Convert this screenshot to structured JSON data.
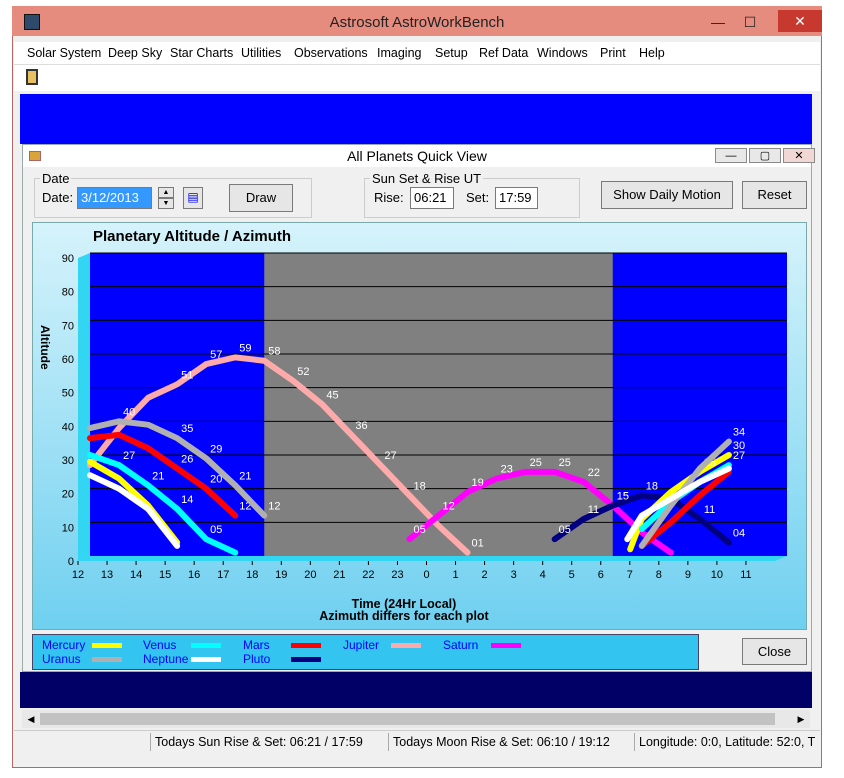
{
  "app": {
    "title": "Astrosoft AstroWorkBench",
    "window_buttons": {
      "minimize": "—",
      "maximize": "☐",
      "close": "✕"
    }
  },
  "menu": [
    "Solar System",
    "Deep Sky",
    "Star Charts",
    "Utilities",
    "Observations",
    "Imaging",
    "Setup",
    "Ref Data",
    "Windows",
    "Print",
    "Help"
  ],
  "child": {
    "title": "All Planets Quick View",
    "window_buttons": {
      "minimize": "—",
      "maximize": "▢",
      "close": "✕"
    },
    "date_group": {
      "title": "Date",
      "date_label": "Date:",
      "date_value": "3/12/2013"
    },
    "draw_label": "Draw",
    "sun_group": {
      "title": "Sun Set & Rise UT",
      "rise_label": "Rise:",
      "rise_value": "06:21",
      "set_label": "Set:",
      "set_value": "17:59"
    },
    "show_daily_motion_label": "Show Daily Motion",
    "reset_label": "Reset",
    "close_label": "Close"
  },
  "legend": [
    {
      "name": "Mercury",
      "color": "#ffff00"
    },
    {
      "name": "Venus",
      "color": "#00ffff"
    },
    {
      "name": "Mars",
      "color": "#ff0000"
    },
    {
      "name": "Jupiter",
      "color": "#ffaaaa"
    },
    {
      "name": "Saturn",
      "color": "#ff00ff"
    },
    {
      "name": "Uranus",
      "color": "#b0b0b0"
    },
    {
      "name": "Neptune",
      "color": "#ffffff"
    },
    {
      "name": "Pluto",
      "color": "#000080"
    }
  ],
  "chart_data": {
    "type": "line",
    "title": "Planetary Altitude / Azimuth",
    "xlabel": "Time (24Hr Local)",
    "xlabel2": "Azimuth differs for each plot",
    "ylabel": "Altitude",
    "ylim": [
      0,
      90
    ],
    "yticks": [
      "0",
      "10",
      "20",
      "30",
      "40",
      "50",
      "60",
      "70",
      "80",
      "90"
    ],
    "xticks": [
      "12",
      "13",
      "14",
      "15",
      "16",
      "17",
      "18",
      "19",
      "20",
      "21",
      "22",
      "23",
      "0",
      "1",
      "2",
      "3",
      "4",
      "5",
      "6",
      "7",
      "8",
      "9",
      "10",
      "11"
    ],
    "night_shade": {
      "from": 18,
      "to": 6
    },
    "colors": {
      "plot_bg": "#0000ff",
      "night": "#808080",
      "gridline": "#000000"
    },
    "series": [
      {
        "name": "Jupiter",
        "color": "#ffaaaa",
        "x": [
          12,
          13,
          14,
          15,
          16,
          17,
          18,
          19,
          20,
          21,
          22,
          23,
          24,
          25
        ],
        "y": [
          27,
          38,
          47,
          51,
          57,
          59,
          58,
          52,
          45,
          36,
          27,
          18,
          9,
          1
        ],
        "labels": [
          "",
          "",
          "",
          "51",
          "57",
          "59",
          "58",
          "52",
          "45",
          "36",
          "27",
          "18",
          "",
          "01"
        ]
      },
      {
        "name": "Saturn",
        "color": "#ff00ff",
        "x": [
          23,
          24,
          25,
          26,
          27,
          28,
          29,
          30,
          31,
          32
        ],
        "y": [
          5,
          12,
          19,
          23,
          25,
          25,
          22,
          15,
          7,
          1
        ],
        "labels": [
          "05",
          "12",
          "19",
          "23",
          "25",
          "25",
          "22",
          "15",
          "",
          ""
        ]
      },
      {
        "name": "Pluto",
        "color": "#000080",
        "x": [
          28,
          29,
          30,
          31,
          32,
          33,
          34
        ],
        "y": [
          5,
          11,
          15,
          18,
          17,
          11,
          4
        ],
        "labels": [
          "05",
          "11",
          "15",
          "18",
          "",
          "11",
          "04"
        ]
      },
      {
        "name": "Mercury",
        "color": "#ffff00",
        "x": [
          12,
          13,
          14,
          15,
          30.6,
          31,
          32,
          33,
          34
        ],
        "y": [
          28,
          23,
          15,
          4,
          2,
          11,
          19,
          25,
          30
        ],
        "labels": [
          "",
          "",
          "",
          "",
          "",
          "",
          "",
          "25",
          "30"
        ]
      },
      {
        "name": "Venus",
        "color": "#00ffff",
        "x": [
          12,
          13,
          14,
          15,
          16,
          17,
          31,
          32,
          33,
          34
        ],
        "y": [
          30,
          27,
          21,
          14,
          5,
          1,
          8,
          16,
          22,
          27
        ],
        "labels": [
          "",
          "27",
          "21",
          "14",
          "05",
          "",
          "",
          "",
          "",
          "27"
        ]
      },
      {
        "name": "Mars",
        "color": "#ff0000",
        "x": [
          12,
          13,
          14,
          15,
          16,
          17,
          31,
          32,
          33,
          34
        ],
        "y": [
          35,
          36,
          32,
          26,
          20,
          12,
          3,
          10,
          18,
          25
        ],
        "labels": [
          "",
          "",
          "",
          "26",
          "20",
          "12",
          "",
          "",
          "",
          ""
        ]
      },
      {
        "name": "Uranus",
        "color": "#b0b0b0",
        "x": [
          12,
          13,
          14,
          15,
          16,
          17,
          18,
          31,
          32,
          33,
          34
        ],
        "y": [
          38,
          40,
          39,
          35,
          29,
          21,
          12,
          3,
          15,
          26,
          34
        ],
        "labels": [
          "",
          "40",
          "",
          "35",
          "29",
          "21",
          "12",
          "",
          "",
          "",
          "34"
        ]
      },
      {
        "name": "Neptune",
        "color": "#ffffff",
        "x": [
          12,
          13,
          14,
          15,
          30.5,
          31,
          32,
          33,
          34
        ],
        "y": [
          24,
          20,
          14,
          3,
          5,
          12,
          17,
          22,
          26
        ],
        "labels": [
          "",
          "",
          "",
          "",
          "",
          "",
          "",
          "",
          ""
        ]
      }
    ]
  },
  "status": {
    "sun": "Todays Sun Rise & Set: 06:21 / 17:59",
    "moon": "Todays Moon Rise & Set: 06:10 / 19:12",
    "location": "Longitude: 0:0, Latitude: 52:0, T"
  }
}
